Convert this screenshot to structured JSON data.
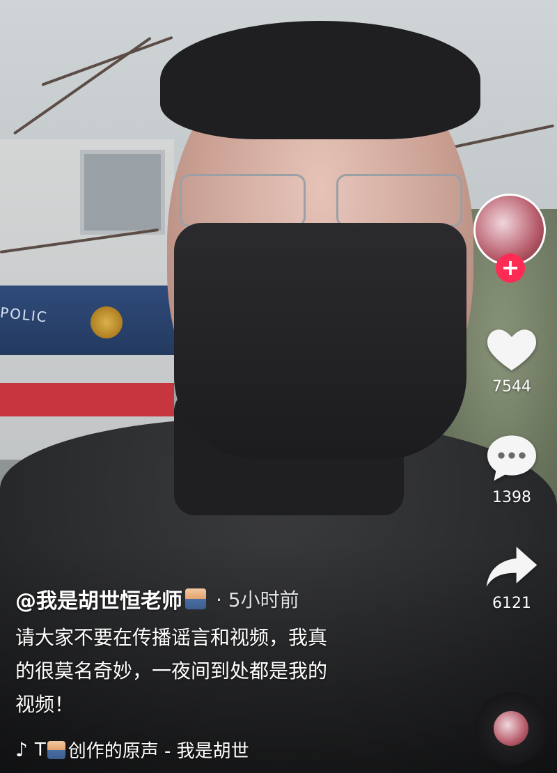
{
  "rail": {
    "likes": "7544",
    "comments": "1398",
    "shares": "6121",
    "follow_symbol": "+"
  },
  "caption": {
    "author": "@我是胡世恒老师",
    "time": "· 5小时前",
    "description_lines": [
      "请大家不要在传播谣言和视频，我真",
      "的很莫名奇妙，一夜间到处都是我的",
      "视频！"
    ]
  },
  "music": {
    "prefix": "T",
    "label": "创作的原声 - 我是胡世"
  },
  "icons": {
    "like": "heart-icon",
    "comment": "comment-bubble-icon",
    "share": "share-arrow-icon",
    "music": "music-note-icon"
  },
  "colors": {
    "follow_button": "#fe2c55",
    "text": "#ffffff"
  }
}
